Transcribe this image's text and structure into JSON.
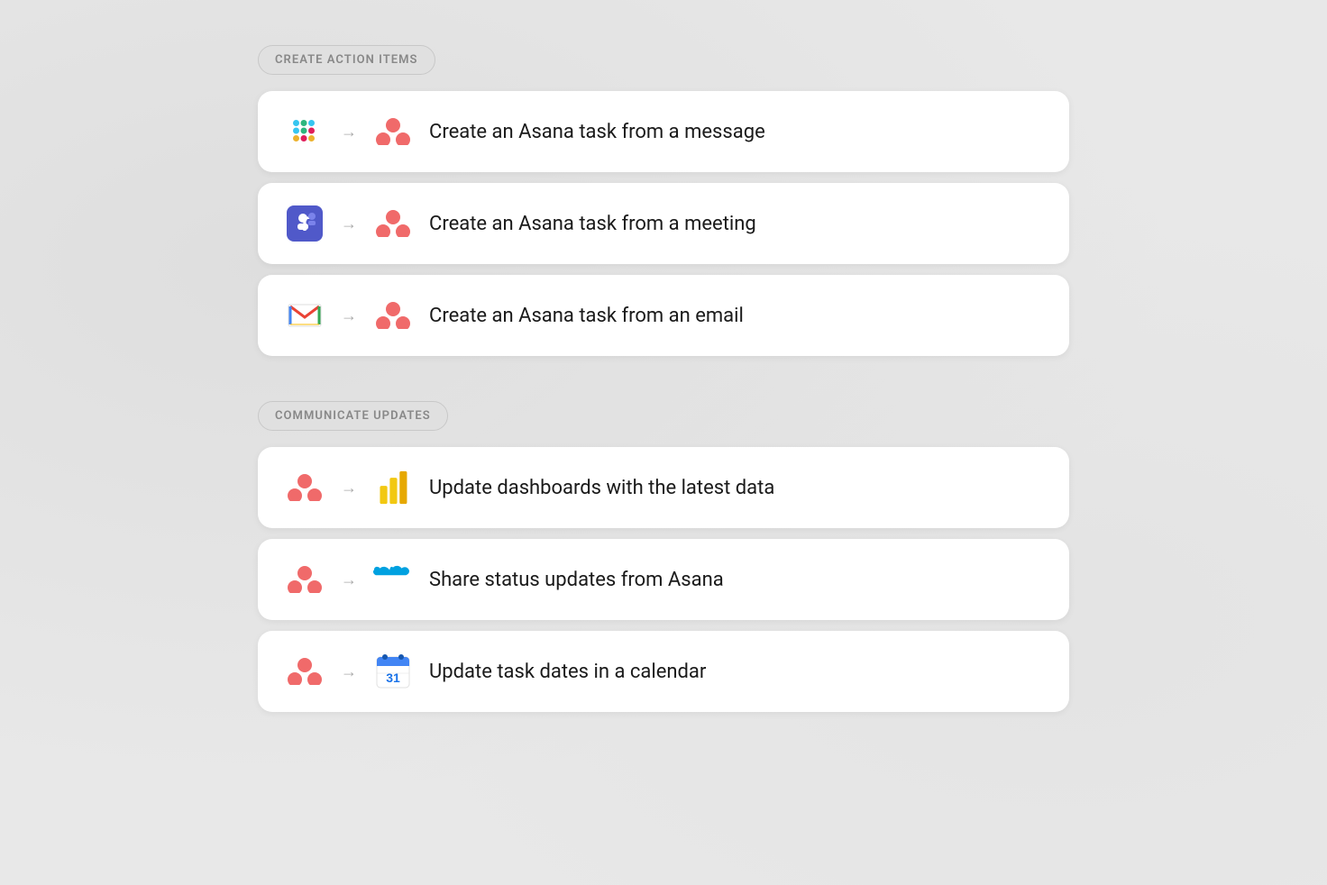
{
  "sections": [
    {
      "id": "create-action-items",
      "label": "CREATE ACTION ITEMS",
      "cards": [
        {
          "id": "slack-to-asana",
          "leftIcon": "slack",
          "rightIcon": "asana",
          "text": "Create an Asana task from a message"
        },
        {
          "id": "teams-to-asana",
          "leftIcon": "teams",
          "rightIcon": "asana",
          "text": "Create an Asana task from a meeting"
        },
        {
          "id": "gmail-to-asana",
          "leftIcon": "gmail",
          "rightIcon": "asana",
          "text": "Create an Asana task from an email"
        }
      ]
    },
    {
      "id": "communicate-updates",
      "label": "COMMUNICATE UPDATES",
      "cards": [
        {
          "id": "asana-to-powerbi",
          "leftIcon": "asana",
          "rightIcon": "powerbi",
          "text": "Update dashboards with the latest data"
        },
        {
          "id": "asana-to-salesforce",
          "leftIcon": "asana",
          "rightIcon": "salesforce",
          "text": "Share status updates from Asana"
        },
        {
          "id": "asana-to-gcal",
          "leftIcon": "asana",
          "rightIcon": "gcal",
          "text": "Update task dates in a calendar"
        }
      ]
    }
  ],
  "arrow": "→"
}
